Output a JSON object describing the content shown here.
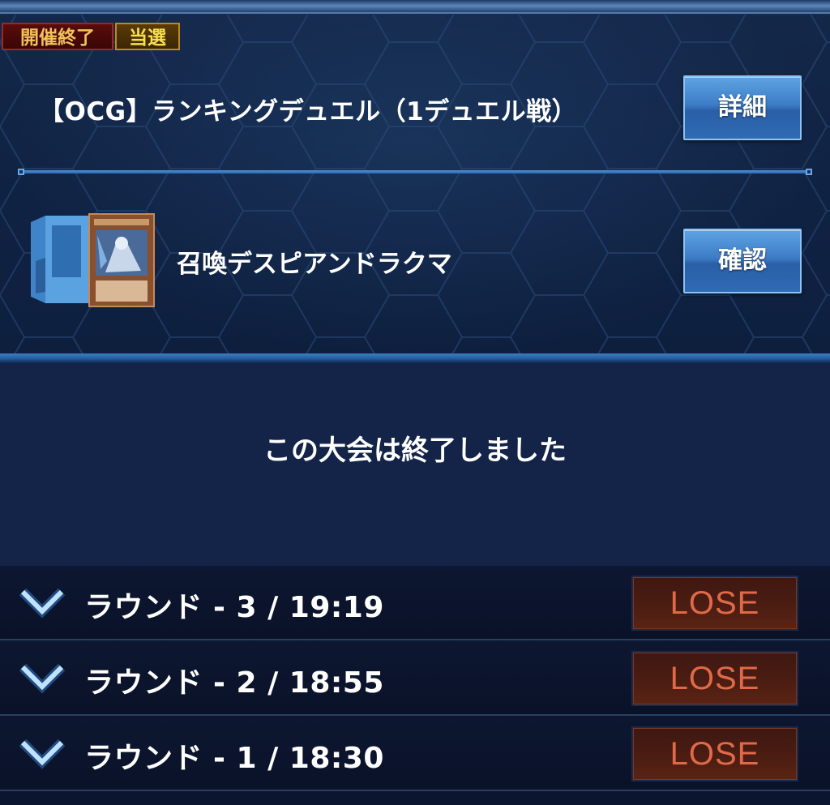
{
  "tournament": {
    "status_badge": "開催終了",
    "result_badge": "当選",
    "title": "【OCG】ランキングデュエル（1デュエル戦）",
    "detail_button": "詳細"
  },
  "deck": {
    "name": "召喚デスピアンドラクマ",
    "confirm_button": "確認"
  },
  "message": "この大会は終了しました",
  "rounds": [
    {
      "label": "ラウンド - 3 / 19:19",
      "result": "LOSE"
    },
    {
      "label": "ラウンド - 2 / 18:55",
      "result": "LOSE"
    },
    {
      "label": "ラウンド - 1 / 18:30",
      "result": "LOSE"
    }
  ],
  "colors": {
    "accent_blue": "#3d7cc6",
    "lose_text": "#e06a48",
    "ended_badge": "#a0261f",
    "won_badge": "#b98a22"
  }
}
